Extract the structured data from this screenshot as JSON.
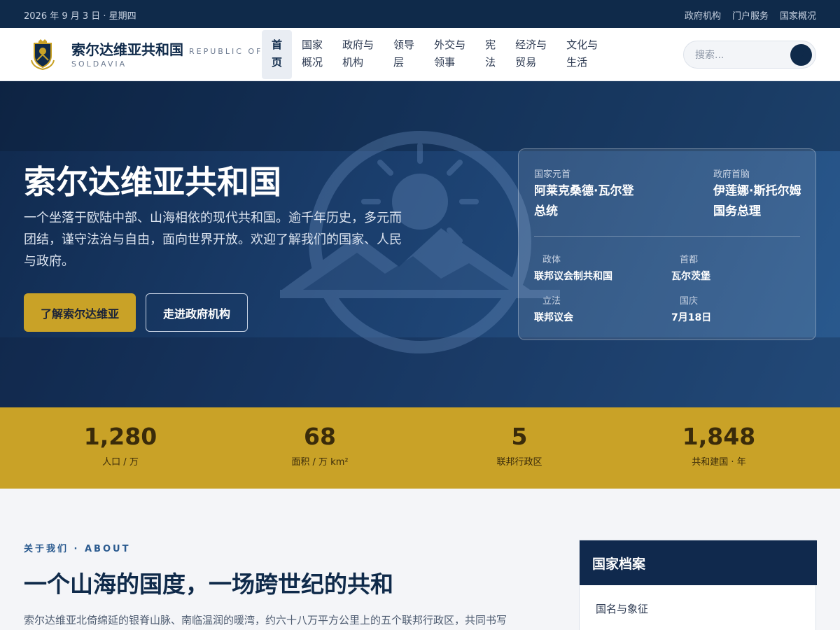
{
  "topbar": {
    "date": "2026 年 9 月 3 日 · 星期四",
    "links": [
      "政府机构",
      "门户服务",
      "国家概况"
    ]
  },
  "header": {
    "brand_name": "索尔达维亚共和国",
    "brand_en_1": "REPUBLIC OF",
    "brand_en_2": "SOLDAVIA",
    "logo_icon": "coat-of-arms-icon",
    "nav": [
      {
        "line1": "首",
        "line2": "页"
      },
      {
        "line1": "国家",
        "line2": "概况"
      },
      {
        "line1": "政府与",
        "line2": "机构"
      },
      {
        "line1": "领导",
        "line2": "层"
      },
      {
        "line1": "外交与",
        "line2": "领事"
      },
      {
        "line1": "宪",
        "line2": "法"
      },
      {
        "line1": "经济与",
        "line2": "贸易"
      },
      {
        "line1": "文化与",
        "line2": "生活"
      }
    ],
    "search_placeholder": "搜索..."
  },
  "hero": {
    "title": "索尔达维亚共和国",
    "description": "一个坐落于欧陆中部、山海相依的现代共和国。逾千年历史，多元而团结，谨守法治与自由，面向世界开放。欢迎了解我们的国家、人民与政府。",
    "primary_button": "了解索尔达维亚",
    "secondary_button": "走进政府机构",
    "emblem_icon": "sun-mountain-emblem-icon"
  },
  "info_card": {
    "head_of_state_label": "国家元首",
    "head_of_state_line1": "阿莱克桑德·瓦尔登",
    "head_of_state_line2": "总统",
    "head_of_gov_label": "政府首脑",
    "head_of_gov_line1": "伊莲娜·斯托尔姆",
    "head_of_gov_line2": "国务总理",
    "facts": [
      {
        "label": "政体",
        "value": "联邦议会制共和国"
      },
      {
        "label": "首都",
        "value": "瓦尔茨堡"
      },
      {
        "label": "立法",
        "value": "联邦议会"
      },
      {
        "label": "国庆",
        "value": "7月18日"
      }
    ]
  },
  "stats": [
    {
      "number": "1,280",
      "label": "人口 / 万"
    },
    {
      "number": "68",
      "label": "面积 / 万 km²"
    },
    {
      "number": "5",
      "label": "联邦行政区"
    },
    {
      "number": "1,848",
      "label": "共和建国 · 年"
    }
  ],
  "about": {
    "kicker": "关于我们 · ABOUT",
    "title": "一个山海的国度，一场跨世纪的共和",
    "text": "索尔达维亚北倚绵延的银脊山脉、南临温润的暖湾，约六十八万平方公里上的五个联邦行政区，共同书写"
  },
  "profile": {
    "title": "国家档案",
    "first_item": "国名与象征"
  },
  "colors": {
    "navy": "#0f2a4a",
    "gold": "#c9a227",
    "hero_blue": "#1b3f6e"
  }
}
